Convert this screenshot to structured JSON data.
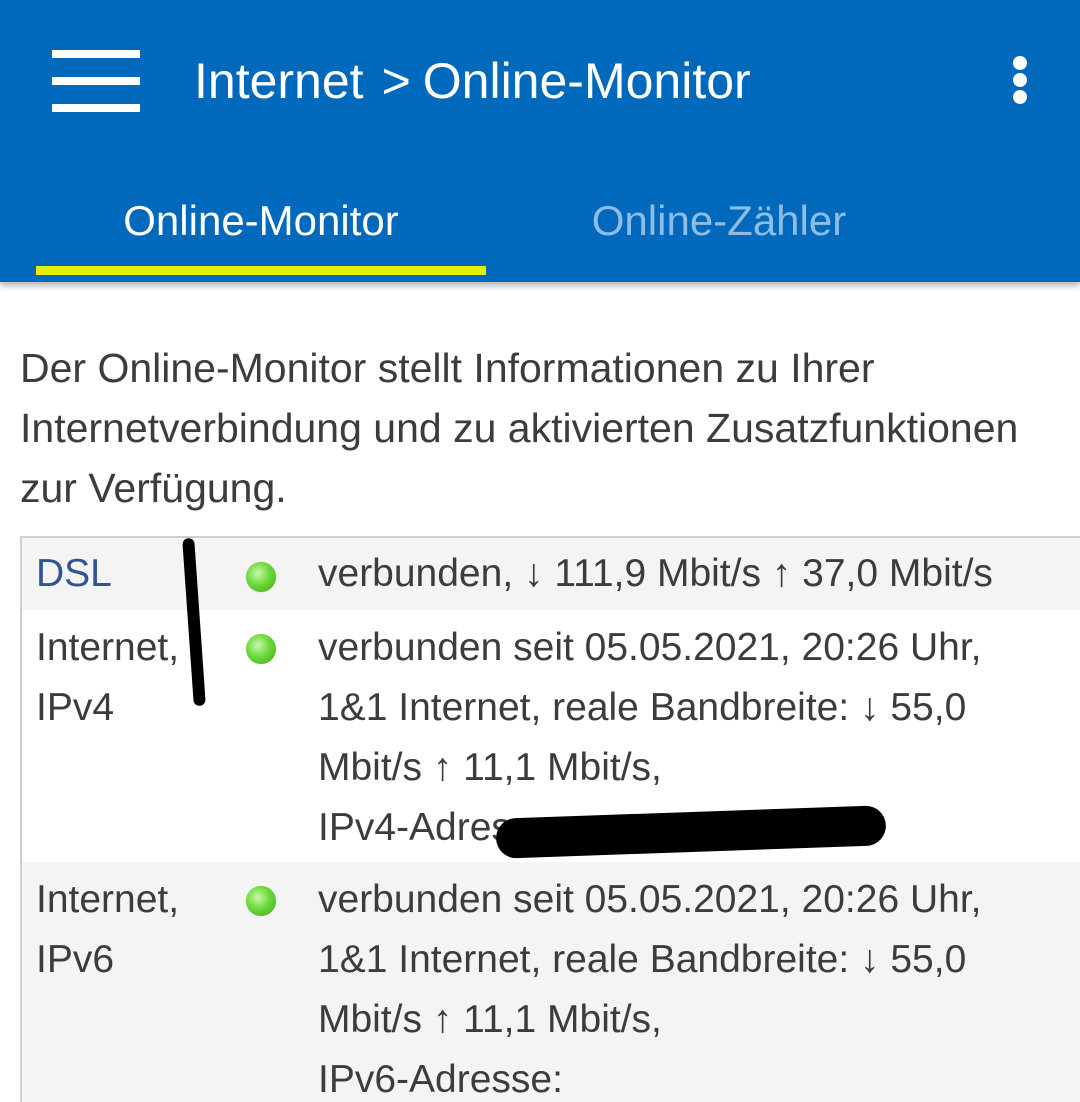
{
  "header": {
    "title_parent": "Internet",
    "title_separator": ">",
    "title_current": "Online-Monitor",
    "menu_icon": "hamburger-menu-icon",
    "more_icon": "more-vertical-icon",
    "background_color": "#0069BC"
  },
  "tabs": [
    {
      "label": "Online-Monitor",
      "active": true
    },
    {
      "label": "Online-Zähler",
      "active": false
    }
  ],
  "tab_indicator_color": "#E6F000",
  "intro": "Der Online-Monitor stellt Informationen zu Ihrer Internetverbindung und zu aktivierten Zusatzfunktionen zur Verfügung.",
  "status_rows": [
    {
      "label": "DSL",
      "status_icon": "green-status-led-icon",
      "value_lines": [
        "verbunden, ↓ 111,9 Mbit/s ↑ 37,0 Mbit/s"
      ]
    },
    {
      "label_lines": [
        "Internet,",
        "IPv4"
      ],
      "status_icon": "green-status-led-icon",
      "value_lines": [
        "verbunden seit 05.05.2021, 20:26 Uhr,",
        "1&1 Internet, reale Bandbreite: ↓ 55,0",
        "Mbit/s ↑ 11,1 Mbit/s,",
        "IPv4-Adresse:"
      ]
    },
    {
      "label_lines": [
        "Internet,",
        "IPv6"
      ],
      "status_icon": "green-status-led-icon",
      "value_lines": [
        "verbunden seit 05.05.2021, 20:26 Uhr,",
        "1&1 Internet, reale Bandbreite: ↓ 55,0",
        "Mbit/s ↑ 11,1 Mbit/s,",
        "IPv6-Adresse:"
      ]
    }
  ]
}
